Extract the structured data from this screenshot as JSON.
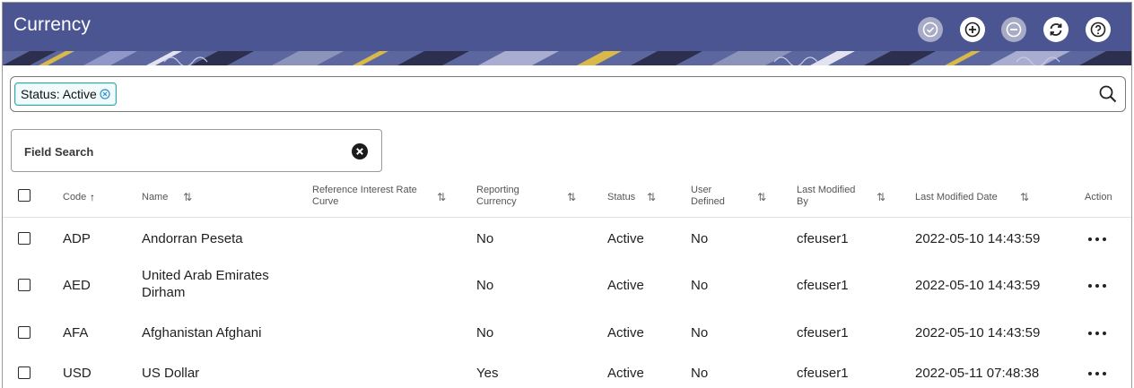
{
  "header": {
    "title": "Currency",
    "brand_color": "#4a5591",
    "actions": [
      {
        "name": "approve-icon",
        "state": "disabled"
      },
      {
        "name": "add-icon",
        "state": "enabled"
      },
      {
        "name": "remove-icon",
        "state": "disabled"
      },
      {
        "name": "refresh-icon",
        "state": "enabled"
      },
      {
        "name": "help-icon",
        "state": "enabled"
      }
    ]
  },
  "filter": {
    "chip_label": "Status: Active",
    "chip_color": "#39a5ad"
  },
  "field_search": {
    "label": "Field Search"
  },
  "table": {
    "columns": {
      "code": "Code",
      "name": "Name",
      "ref_rate": "Reference Interest Rate Curve",
      "reporting": "Reporting Currency",
      "status": "Status",
      "user_defined": "User Defined",
      "modified_by": "Last Modified By",
      "modified_date": "Last Modified Date",
      "action": "Action"
    },
    "sort_asc_icon": "↑",
    "sort_icon": "⇅",
    "rows": [
      {
        "code": "ADP",
        "name": "Andorran Peseta",
        "ref_rate": "",
        "reporting": "No",
        "status": "Active",
        "user_defined": "No",
        "modified_by": "cfeuser1",
        "modified_date": "2022-05-10 14:43:59"
      },
      {
        "code": "AED",
        "name": "United Arab Emirates Dirham",
        "ref_rate": "",
        "reporting": "No",
        "status": "Active",
        "user_defined": "No",
        "modified_by": "cfeuser1",
        "modified_date": "2022-05-10 14:43:59"
      },
      {
        "code": "AFA",
        "name": "Afghanistan Afghani",
        "ref_rate": "",
        "reporting": "No",
        "status": "Active",
        "user_defined": "No",
        "modified_by": "cfeuser1",
        "modified_date": "2022-05-10 14:43:59"
      },
      {
        "code": "USD",
        "name": "US Dollar",
        "ref_rate": "",
        "reporting": "Yes",
        "status": "Active",
        "user_defined": "No",
        "modified_by": "cfeuser1",
        "modified_date": "2022-05-11 07:48:38"
      }
    ]
  }
}
